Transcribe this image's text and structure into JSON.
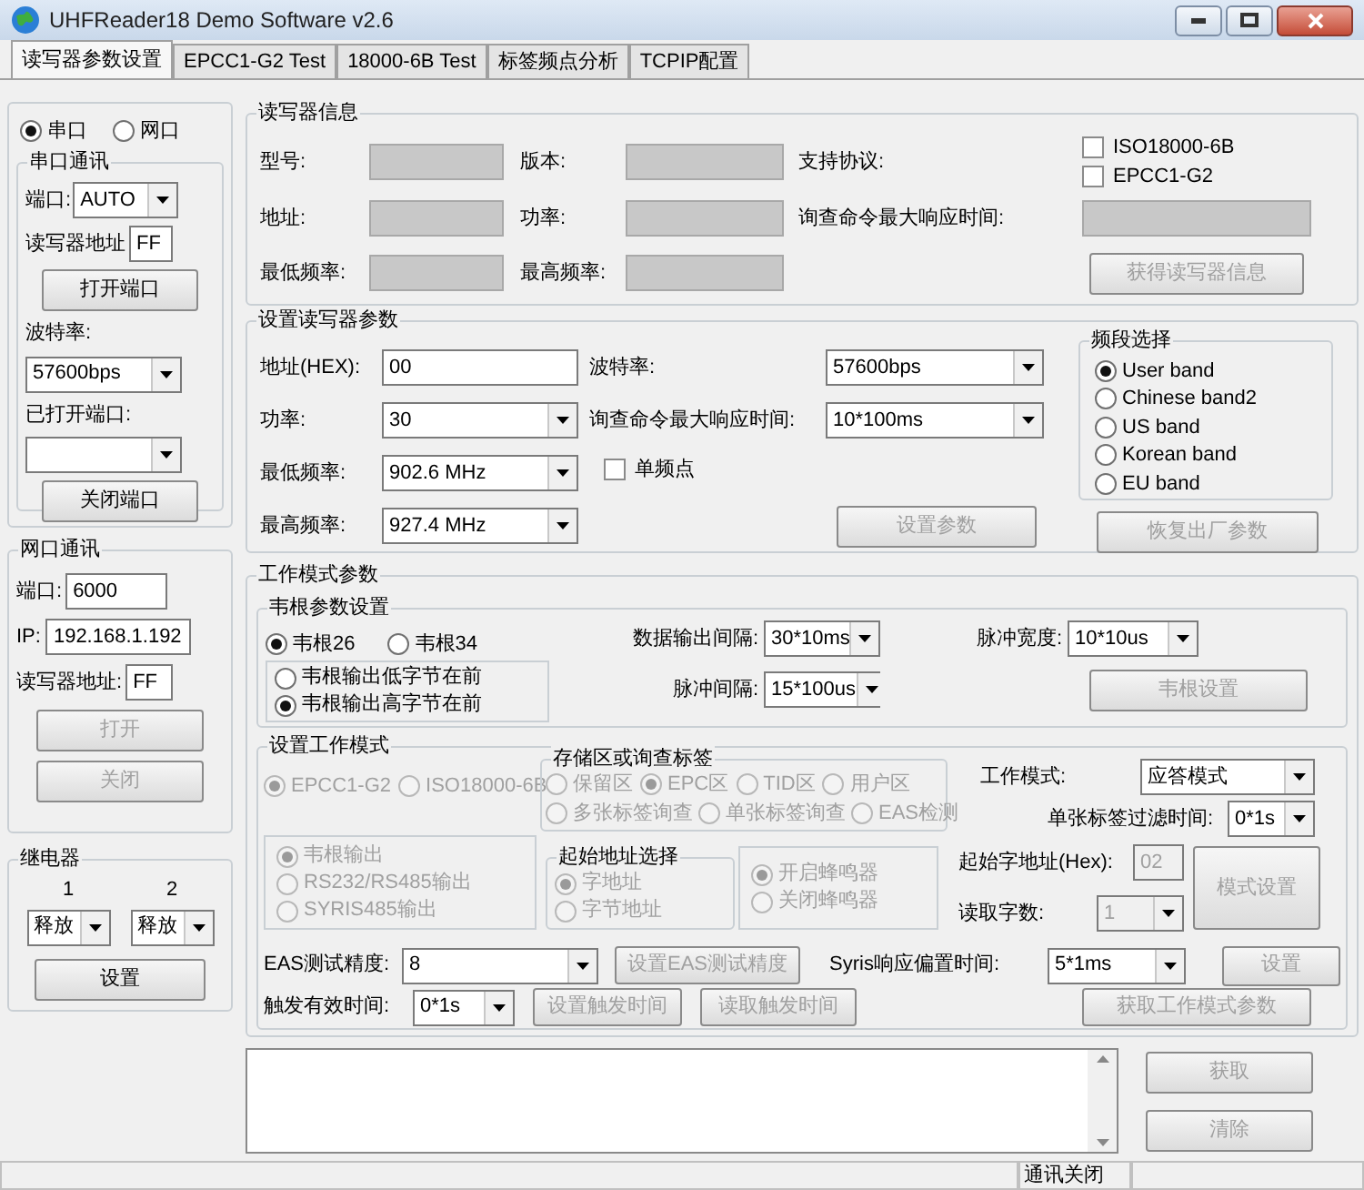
{
  "window": {
    "title": "UHFReader18 Demo Software v2.6"
  },
  "tabs": [
    {
      "label": "读写器参数设置",
      "selected": true
    },
    {
      "label": "EPCC1-G2 Test",
      "selected": false
    },
    {
      "label": "18000-6B Test",
      "selected": false
    },
    {
      "label": "标签频点分析",
      "selected": false
    },
    {
      "label": "TCPIP配置",
      "selected": false
    }
  ],
  "comm": {
    "mode": [
      {
        "label": "串口",
        "selected": true
      },
      {
        "label": "网口",
        "selected": false
      }
    ],
    "serial": {
      "title": "串口通讯",
      "port_label": "端口:",
      "port": "AUTO",
      "address_label": "读写器地址",
      "address": "FF",
      "open_button": {
        "label": "打开端口",
        "disabled": false
      },
      "baud_label": "波特率:",
      "baud": "57600bps",
      "opened_label": "已打开端口:",
      "close_button": {
        "label": "关闭端口",
        "disabled": false
      }
    },
    "network": {
      "title": "网口通讯",
      "port_label": "端口:",
      "port": "6000",
      "ip_label": "IP:",
      "ip": "192.168.1.192",
      "address_label": "读写器地址:",
      "address": "FF",
      "open_button": {
        "label": "打开",
        "disabled": true
      },
      "close_button": {
        "label": "关闭",
        "disabled": true
      }
    },
    "relay": {
      "title": "继电器",
      "channels": [
        {
          "label": "1",
          "value": "释放"
        },
        {
          "label": "2",
          "value": "释放"
        }
      ],
      "button": {
        "label": "设置",
        "disabled": false
      }
    }
  },
  "reader_info": {
    "title": "读写器信息",
    "model_label": "型号:",
    "version_label": "版本:",
    "protocol_label": "支持协议:",
    "protocols": [
      {
        "label": "ISO18000-6B",
        "checked": false
      },
      {
        "label": "EPCC1-G2",
        "checked": false
      }
    ],
    "address_label": "地址:",
    "power_label": "功率:",
    "max_response_label": "询查命令最大响应时间:",
    "min_freq_label": "最低频率:",
    "max_freq_label": "最高频率:",
    "button": {
      "label": "获得读写器信息",
      "disabled": true
    }
  },
  "reader_params": {
    "title": "设置读写器参数",
    "address_label": "地址(HEX):",
    "address": "00",
    "baud_label": "波特率:",
    "baud": "57600bps",
    "power_label": "功率:",
    "power": "30",
    "max_response_label": "询查命令最大响应时间:",
    "max_response": "10*100ms",
    "min_freq_label": "最低频率:",
    "min_freq": "902.6 MHz",
    "single_freq": {
      "label": "单频点",
      "checked": false
    },
    "max_freq_label": "最高频率:",
    "max_freq": "927.4 MHz",
    "set_button": {
      "label": "设置参数",
      "disabled": true
    },
    "reset_button": {
      "label": "恢复出厂参数",
      "disabled": true
    },
    "band": {
      "title": "频段选择",
      "options": [
        {
          "label": "User band",
          "selected": true
        },
        {
          "label": "Chinese band2",
          "selected": false
        },
        {
          "label": "US band",
          "selected": false
        },
        {
          "label": "Korean band",
          "selected": false
        },
        {
          "label": "EU band",
          "selected": false
        }
      ]
    }
  },
  "work_mode": {
    "title": "工作模式参数",
    "wiegand": {
      "title": "韦根参数设置",
      "formats": [
        {
          "label": "韦根26",
          "selected": true
        },
        {
          "label": "韦根34",
          "selected": false
        }
      ],
      "byte_order": [
        {
          "label": "韦根输出低字节在前",
          "selected": false
        },
        {
          "label": "韦根输出高字节在前",
          "selected": true
        }
      ],
      "interval_label": "数据输出间隔:",
      "interval": "30*10ms",
      "pulse_width_label": "脉冲宽度:",
      "pulse_width": "10*10us",
      "pulse_interval_label": "脉冲间隔:",
      "pulse_interval": "15*100us",
      "button": {
        "label": "韦根设置",
        "disabled": true
      }
    },
    "mode": {
      "title": "设置工作模式",
      "disabled": true,
      "protocols": [
        {
          "label": "EPCC1-G2",
          "selected": true
        },
        {
          "label": "ISO18000-6B",
          "selected": false
        }
      ],
      "memory": {
        "title": "存储区或询查标签",
        "areas": [
          {
            "label": "保留区",
            "selected": false
          },
          {
            "label": "EPC区",
            "selected": true
          },
          {
            "label": "TID区",
            "selected": false
          },
          {
            "label": "用户区",
            "selected": false
          }
        ],
        "inquiry": [
          {
            "label": "多张标签询查",
            "selected": false
          },
          {
            "label": "单张标签询查",
            "selected": false
          },
          {
            "label": "EAS检测",
            "selected": false
          }
        ]
      },
      "output": [
        {
          "label": "韦根输出",
          "selected": true
        },
        {
          "label": "RS232/RS485输出",
          "selected": false
        },
        {
          "label": "SYRIS485输出",
          "selected": false
        }
      ],
      "start_address": {
        "title": "起始地址选择",
        "options": [
          {
            "label": "字地址",
            "selected": true
          },
          {
            "label": "字节地址",
            "selected": false
          }
        ]
      },
      "buzzer": [
        {
          "label": "开启蜂鸣器",
          "selected": true
        },
        {
          "label": "关闭蜂鸣器",
          "selected": false
        }
      ],
      "work_mode_label": "工作模式:",
      "work_mode": "应答模式",
      "filter_label": "单张标签过滤时间:",
      "filter": "0*1s",
      "start_word_label": "起始字地址(Hex):",
      "start_word": "02",
      "word_count_label": "读取字数:",
      "word_count": "1",
      "mode_button": {
        "label": "模式设置",
        "disabled": true
      },
      "eas_label": "EAS测试精度:",
      "eas": "8",
      "eas_button": {
        "label": "设置EAS测试精度",
        "disabled": true
      },
      "syris_label": "Syris响应偏置时间:",
      "syris": "5*1ms",
      "syris_button": {
        "label": "设置",
        "disabled": true
      },
      "trigger_label": "触发有效时间:",
      "trigger": "0*1s",
      "set_trigger_button": {
        "label": "设置触发时间",
        "disabled": true
      },
      "read_trigger_button": {
        "label": "读取触发时间",
        "disabled": true
      },
      "get_button": {
        "label": "获取工作模式参数",
        "disabled": true
      }
    }
  },
  "log": {
    "get_button": {
      "label": "获取",
      "disabled": true
    },
    "clear_button": {
      "label": "清除",
      "disabled": true
    }
  },
  "status_bar": {
    "status": "通讯关闭"
  }
}
